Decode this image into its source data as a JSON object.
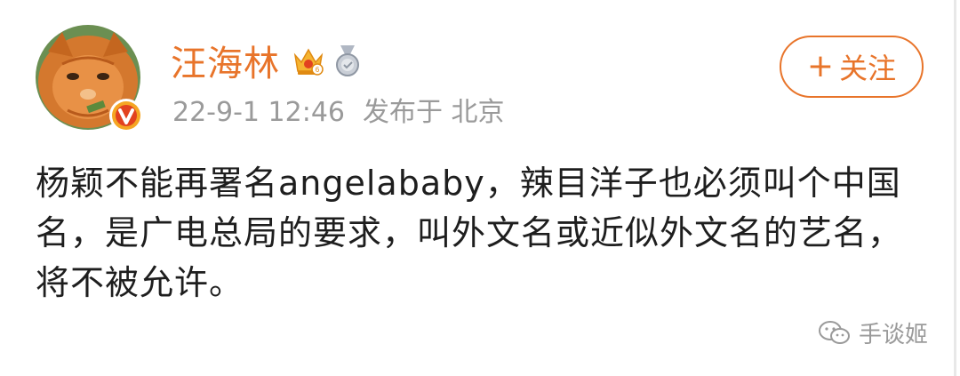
{
  "post": {
    "username": "汪海林",
    "timestamp": "22-9-1 12:46",
    "source": "发布于 北京",
    "follow_label": "关注",
    "follow_plus": "+",
    "text": "杨颖不能再署名angelababy，辣目洋子也必须叫个中国名，是广电总局的要求，叫外文名或近似外文名的艺名，将不被允许。"
  },
  "watermark": {
    "label": "手谈姬"
  },
  "icons": {
    "avatar": "orange-cat-avatar",
    "verified": "verified-v-icon",
    "vip": "crown-vip-icon",
    "medal": "medal-icon",
    "wechat": "wechat-icon"
  },
  "colors": {
    "accent": "#e8742a",
    "meta": "#9a9a9a",
    "text": "#1e1e1e",
    "verified_badge": "#f5a623"
  }
}
